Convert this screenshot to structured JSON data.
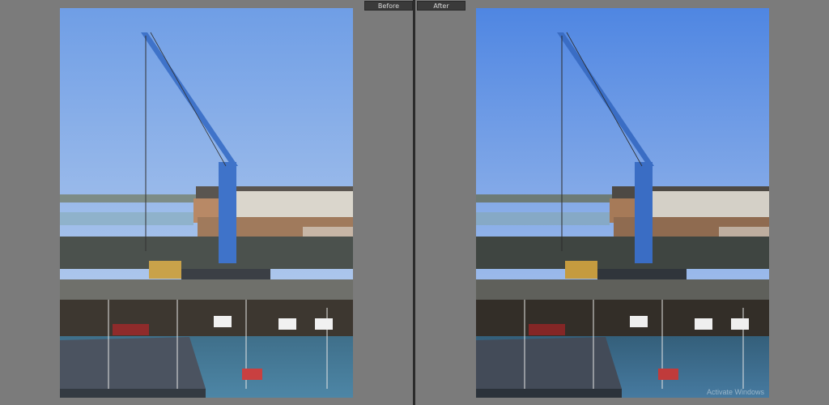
{
  "labels": {
    "before": "Before",
    "after": "After"
  },
  "watermark": "Activate Windows",
  "colors": {
    "background": "#7b7b7b",
    "divider": "#2b2b2b",
    "tab_bg": "#3a3a3a",
    "before_sky_top": "#6f9ee6",
    "before_sky_bottom": "#c6d7ee",
    "after_sky_top": "#4f86e2",
    "after_sky_bottom": "#bcd0ee",
    "crane": "#3f73c9"
  }
}
